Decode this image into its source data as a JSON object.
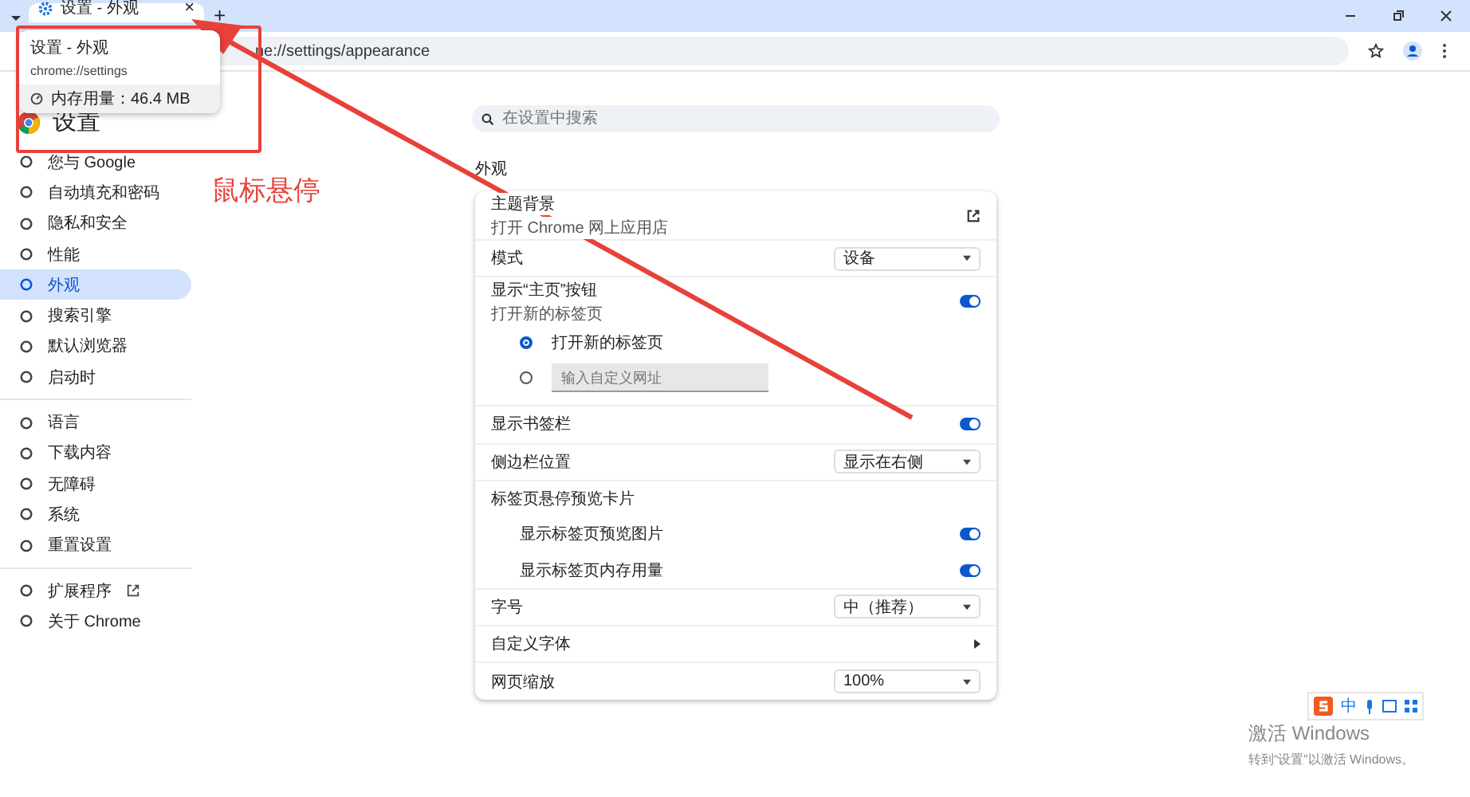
{
  "tab": {
    "title": "设置 - 外观",
    "close": "×"
  },
  "new_tab": "+",
  "omnibox": {
    "url": "ne://settings/appearance"
  },
  "hover_card": {
    "title": "设置 - 外观",
    "url": "chrome://settings",
    "memory": "内存用量：46.4 MB"
  },
  "settings_title": "设置",
  "search": {
    "placeholder": "在设置中搜索"
  },
  "sidebar": {
    "groups": [
      [
        {
          "label": "您与 Google",
          "selected": false
        },
        {
          "label": "自动填充和密码",
          "selected": false
        },
        {
          "label": "隐私和安全",
          "selected": false
        },
        {
          "label": "性能",
          "selected": false
        },
        {
          "label": "外观",
          "selected": true
        },
        {
          "label": "搜索引擎",
          "selected": false
        },
        {
          "label": "默认浏览器",
          "selected": false
        },
        {
          "label": "启动时",
          "selected": false
        }
      ],
      [
        {
          "label": "语言",
          "selected": false
        },
        {
          "label": "下载内容",
          "selected": false
        },
        {
          "label": "无障碍",
          "selected": false
        },
        {
          "label": "系统",
          "selected": false
        },
        {
          "label": "重置设置",
          "selected": false
        }
      ],
      [
        {
          "label": "扩展程序",
          "selected": false
        },
        {
          "label": "关于 Chrome",
          "selected": false
        }
      ]
    ]
  },
  "section_title": "外观",
  "rows": [
    {
      "kind": "link",
      "label": "主题背景",
      "sublabel": "打开 Chrome 网上应用店"
    },
    {
      "kind": "select",
      "label": "模式",
      "value": "设备"
    },
    {
      "kind": "toggle",
      "label": "显示“主页”按钮",
      "sublabel": "打开新的标签页",
      "on": true,
      "options": [
        {
          "kind": "radio",
          "label": "打开新的标签页",
          "selected": true
        },
        {
          "kind": "input",
          "placeholder": "输入自定义网址",
          "selected": false
        }
      ]
    },
    {
      "kind": "toggle",
      "label": "显示书签栏",
      "on": true
    },
    {
      "kind": "select",
      "label": "侧边栏位置",
      "value": "显示在右侧"
    },
    {
      "kind": "heading",
      "label": "标签页悬停预览卡片",
      "children": [
        {
          "kind": "toggle",
          "label": "显示标签页预览图片",
          "on": true
        },
        {
          "kind": "toggle",
          "label": "显示标签页内存用量",
          "on": true
        }
      ]
    },
    {
      "kind": "select",
      "label": "字号",
      "value": "中（推荐）"
    },
    {
      "kind": "arrow",
      "label": "自定义字体"
    },
    {
      "kind": "select",
      "label": "网页缩放",
      "value": "100%"
    }
  ],
  "annotation": {
    "label": "鼠标悬停"
  },
  "activation": {
    "title": "激活 Windows",
    "subtitle": "转到“设置”以激活 Windows。"
  },
  "ime": {
    "label": "中"
  }
}
